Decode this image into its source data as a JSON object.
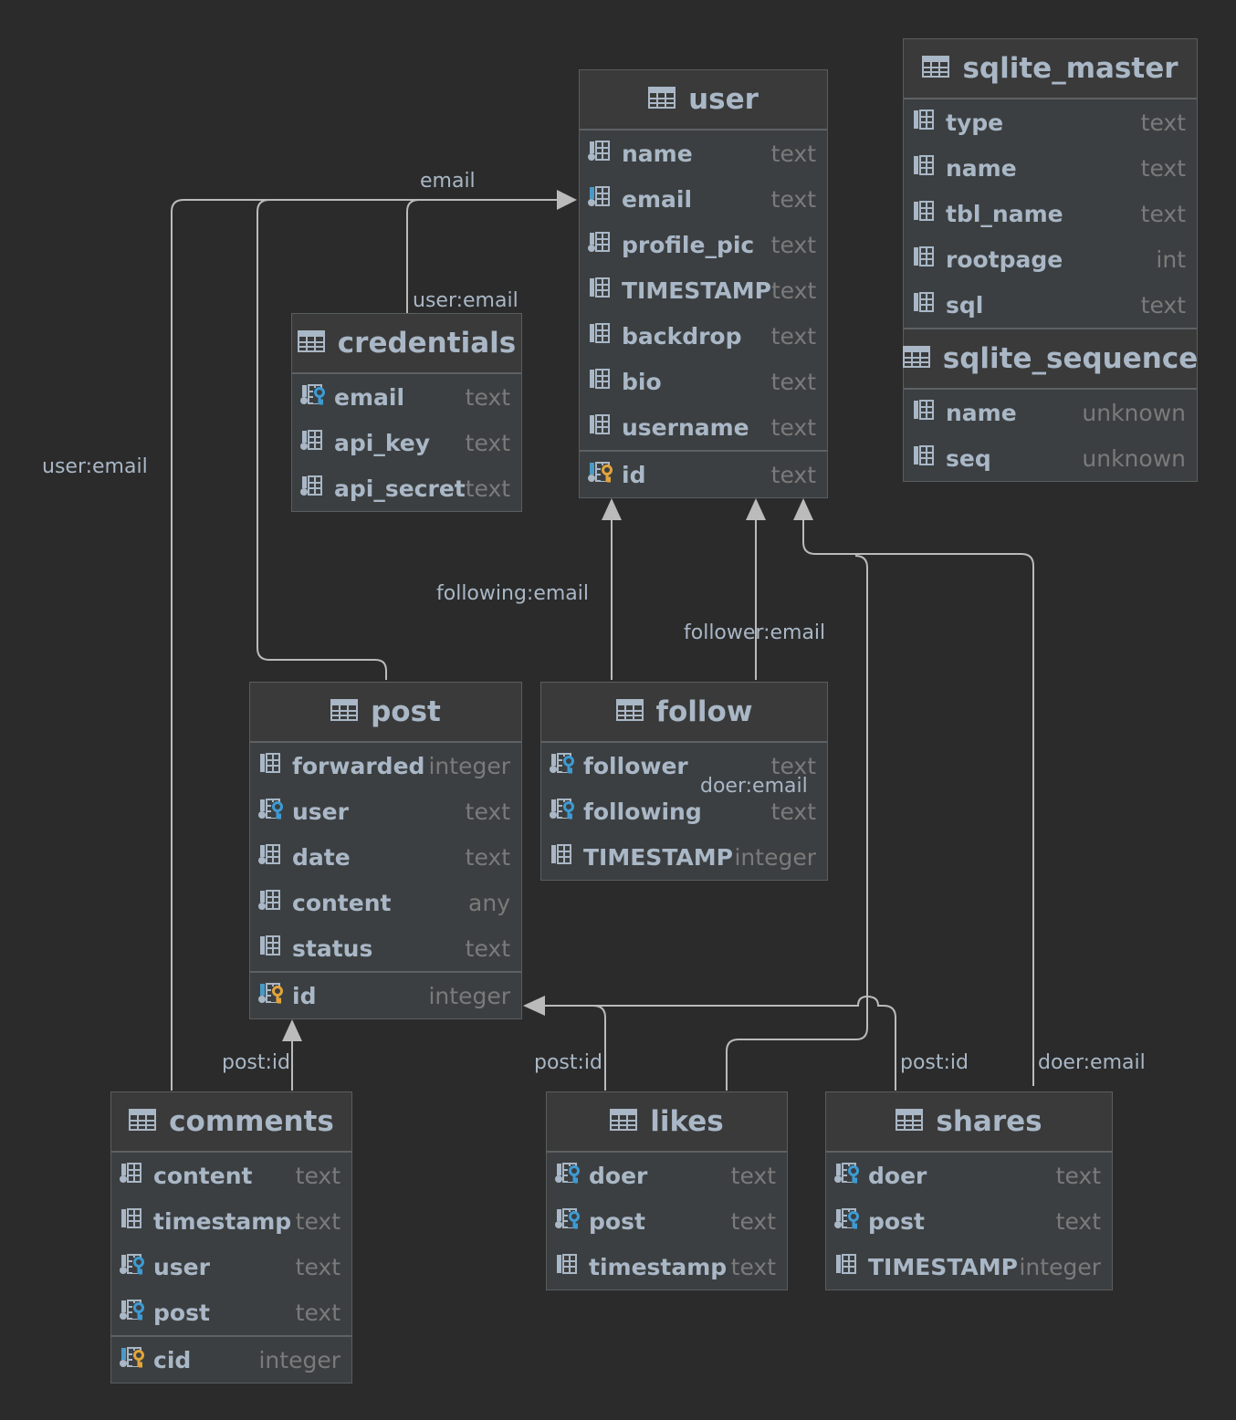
{
  "colors": {
    "background": "#2b2b2b",
    "table": "#3c3f41",
    "text": "#a9b7c6",
    "type": "#7a7a7a",
    "fk_key": "#3d9bd4",
    "pk_key": "#e2a43a",
    "edge": "#bbbbbb"
  },
  "tables": {
    "user": {
      "title": "user",
      "columns": [
        {
          "name": "name",
          "type": "text",
          "icon": "column-notnull"
        },
        {
          "name": "email",
          "type": "text",
          "icon": "column-indexed"
        },
        {
          "name": "profile_pic",
          "type": "text",
          "icon": "column-notnull"
        },
        {
          "name": "TIMESTAMP",
          "type": "text",
          "icon": "column"
        },
        {
          "name": "backdrop",
          "type": "text",
          "icon": "column"
        },
        {
          "name": "bio",
          "type": "text",
          "icon": "column"
        },
        {
          "name": "username",
          "type": "text",
          "icon": "column"
        }
      ],
      "keys": [
        {
          "name": "id",
          "type": "text",
          "icon": "primary-key"
        }
      ]
    },
    "sqlite_master": {
      "title": "sqlite_master",
      "columns": [
        {
          "name": "type",
          "type": "text",
          "icon": "column"
        },
        {
          "name": "name",
          "type": "text",
          "icon": "column"
        },
        {
          "name": "tbl_name",
          "type": "text",
          "icon": "column"
        },
        {
          "name": "rootpage",
          "type": "int",
          "icon": "column"
        },
        {
          "name": "sql",
          "type": "text",
          "icon": "column"
        }
      ],
      "sub_title": "sqlite_sequence",
      "sub_columns": [
        {
          "name": "name",
          "type": "unknown",
          "icon": "column"
        },
        {
          "name": "seq",
          "type": "unknown",
          "icon": "column"
        }
      ]
    },
    "credentials": {
      "title": "credentials",
      "columns": [
        {
          "name": "email",
          "type": "text",
          "icon": "foreign-key"
        },
        {
          "name": "api_key",
          "type": "text",
          "icon": "column-notnull"
        },
        {
          "name": "api_secret",
          "type": "text",
          "icon": "column-notnull"
        }
      ]
    },
    "post": {
      "title": "post",
      "columns": [
        {
          "name": "forwarded",
          "type": "integer",
          "icon": "column"
        },
        {
          "name": "user",
          "type": "text",
          "icon": "foreign-key"
        },
        {
          "name": "date",
          "type": "text",
          "icon": "column-notnull"
        },
        {
          "name": "content",
          "type": "any",
          "icon": "column-notnull"
        },
        {
          "name": "status",
          "type": "text",
          "icon": "column"
        }
      ],
      "keys": [
        {
          "name": "id",
          "type": "integer",
          "icon": "primary-key"
        }
      ]
    },
    "follow": {
      "title": "follow",
      "columns": [
        {
          "name": "follower",
          "type": "text",
          "icon": "foreign-key"
        },
        {
          "name": "following",
          "type": "text",
          "icon": "foreign-key"
        },
        {
          "name": "TIMESTAMP",
          "type": "integer",
          "icon": "column"
        }
      ]
    },
    "comments": {
      "title": "comments",
      "columns": [
        {
          "name": "content",
          "type": "text",
          "icon": "column-notnull"
        },
        {
          "name": "timestamp",
          "type": "text",
          "icon": "column"
        },
        {
          "name": "user",
          "type": "text",
          "icon": "foreign-key"
        },
        {
          "name": "post",
          "type": "text",
          "icon": "foreign-key"
        }
      ],
      "keys": [
        {
          "name": "cid",
          "type": "integer",
          "icon": "primary-key"
        }
      ]
    },
    "likes": {
      "title": "likes",
      "columns": [
        {
          "name": "doer",
          "type": "text",
          "icon": "foreign-key"
        },
        {
          "name": "post",
          "type": "text",
          "icon": "foreign-key"
        },
        {
          "name": "timestamp",
          "type": "text",
          "icon": "column"
        }
      ]
    },
    "shares": {
      "title": "shares",
      "columns": [
        {
          "name": "doer",
          "type": "text",
          "icon": "foreign-key"
        },
        {
          "name": "post",
          "type": "text",
          "icon": "foreign-key"
        },
        {
          "name": "TIMESTAMP",
          "type": "integer",
          "icon": "column"
        }
      ]
    }
  },
  "edge_labels": {
    "email": "email",
    "credentials_user_email": "user:email",
    "comments_user_email": "user:email",
    "following_email": "following:email",
    "follower_email": "follower:email",
    "doer_email_likes": "doer:email",
    "post_id_comments": "post:id",
    "post_id_likes": "post:id",
    "post_id_shares": "post:id",
    "doer_email_shares": "doer:email"
  }
}
